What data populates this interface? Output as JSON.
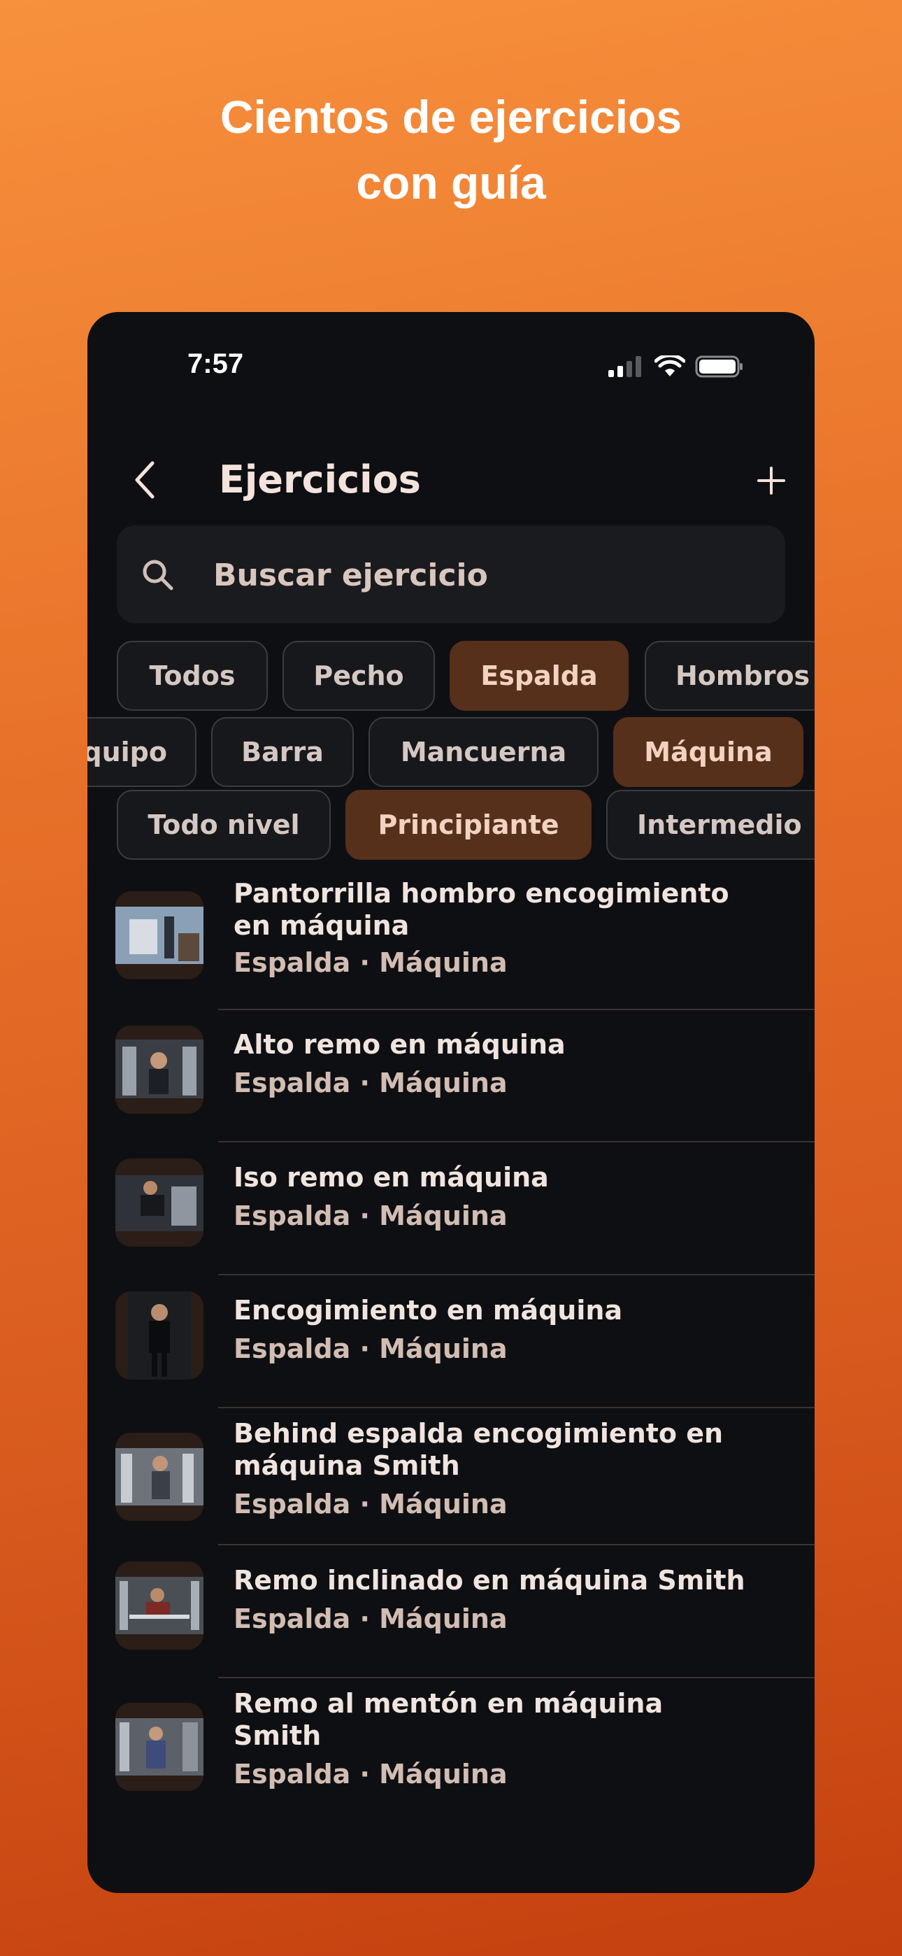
{
  "headline": {
    "line1": "Cientos de ejercicios",
    "line2": "con guía"
  },
  "status_bar": {
    "time": "7:57"
  },
  "nav": {
    "title": "Ejercicios"
  },
  "search": {
    "placeholder": "Buscar ejercicio"
  },
  "filters": {
    "muscles": [
      {
        "label": "Todos",
        "active": false
      },
      {
        "label": "Pecho",
        "active": false
      },
      {
        "label": "Espalda",
        "active": true
      },
      {
        "label": "Hombros",
        "active": false
      }
    ],
    "equipment": [
      {
        "label": "quipo",
        "active": false
      },
      {
        "label": "Barra",
        "active": false
      },
      {
        "label": "Mancuerna",
        "active": false
      },
      {
        "label": "Máquina",
        "active": true
      }
    ],
    "levels": [
      {
        "label": "Todo nivel",
        "active": false
      },
      {
        "label": "Principiante",
        "active": true
      },
      {
        "label": "Intermedio",
        "active": false
      }
    ]
  },
  "exercises": [
    {
      "title_lines": [
        "Pantorrilla hombro encogimiento",
        "en máquina"
      ],
      "subtitle": "Espalda · Máquina"
    },
    {
      "title_lines": [
        "Alto remo en máquina"
      ],
      "subtitle": "Espalda · Máquina"
    },
    {
      "title_lines": [
        "Iso remo en máquina"
      ],
      "subtitle": "Espalda · Máquina"
    },
    {
      "title_lines": [
        "Encogimiento en máquina"
      ],
      "subtitle": "Espalda · Máquina"
    },
    {
      "title_lines": [
        "Behind espalda encogimiento en",
        "máquina Smith"
      ],
      "subtitle": "Espalda · Máquina"
    },
    {
      "title_lines": [
        "Remo inclinado en máquina Smith"
      ],
      "subtitle": "Espalda · Máquina"
    },
    {
      "title_lines": [
        "Remo al mentón en máquina",
        "Smith"
      ],
      "subtitle": "Espalda · Máquina"
    }
  ]
}
